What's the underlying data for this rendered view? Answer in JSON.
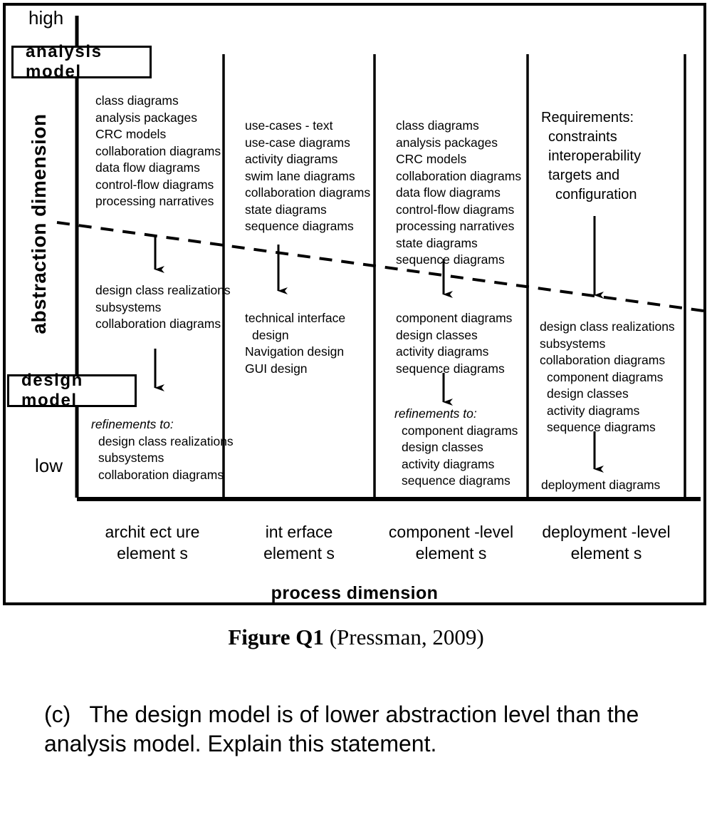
{
  "figure": {
    "axis": {
      "y_label": "abstraction dimension",
      "y_high": "high",
      "y_low": "low",
      "x_label": "process dimension"
    },
    "model_boxes": {
      "analysis": "analysis model",
      "design": "design model"
    },
    "columns": [
      {
        "id": "architecture",
        "caption_line1": "archit ect ure",
        "caption_line2": "element s",
        "top_items": [
          "class diagrams",
          "analysis packages",
          "CRC models",
          "collaboration diagrams",
          "data flow diagrams",
          "control-flow diagrams",
          "processing narratives"
        ],
        "mid_items": [
          "design class realizations",
          "subsystems",
          "collaboration diagrams"
        ],
        "refinements_label": "refinements to:",
        "bottom_items": [
          "design class realizations",
          "subsystems",
          "collaboration diagrams"
        ]
      },
      {
        "id": "interface",
        "caption_line1": "int erface",
        "caption_line2": "element s",
        "top_items": [
          "use-cases - text",
          "use-case diagrams",
          "activity diagrams",
          "swim lane diagrams",
          "collaboration diagrams",
          "state diagrams",
          "sequence diagrams"
        ],
        "mid_items": [
          "technical interface",
          "design",
          "Navigation design",
          "GUI design"
        ],
        "refinements_label": "",
        "bottom_items": []
      },
      {
        "id": "component-level",
        "caption_line1": "component -level",
        "caption_line2": "element s",
        "top_items": [
          "class diagrams",
          "analysis packages",
          "CRC models",
          "collaboration diagrams",
          "data flow diagrams",
          "control-flow diagrams",
          "processing narratives",
          "state diagrams",
          "sequence diagrams"
        ],
        "mid_items": [
          "component diagrams",
          "design classes",
          "activity diagrams",
          "sequence diagrams"
        ],
        "refinements_label": "refinements to:",
        "bottom_items": [
          "component diagrams",
          "design classes",
          "activity diagrams",
          "sequence diagrams"
        ]
      },
      {
        "id": "deployment-level",
        "caption_line1": "deployment -level",
        "caption_line2": "element s",
        "top_items": [
          "Requirements:",
          "constraints",
          "interoperability",
          "targets and",
          "configuration"
        ],
        "mid_items": [
          "design class realizations",
          "subsystems",
          "collaboration diagrams",
          "component diagrams",
          "design classes",
          "activity diagrams",
          "sequence diagrams"
        ],
        "refinements_label": "",
        "bottom_items": [
          "deployment diagrams"
        ]
      }
    ]
  },
  "caption": {
    "label": "Figure Q1 ",
    "source": "(Pressman, 2009)"
  },
  "question": {
    "marker": "(c)",
    "text": "The design model is of lower abstraction level than the analysis model. Explain this statement."
  },
  "colors": {
    "ink": "#000000",
    "paper": "#ffffff"
  }
}
